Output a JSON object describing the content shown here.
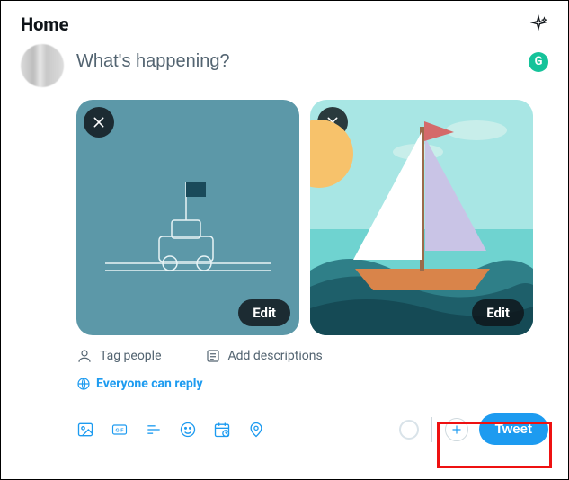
{
  "header": {
    "title": "Home"
  },
  "composer": {
    "placeholder": "What's happening?",
    "grammarly_label": "G"
  },
  "media": [
    {
      "edit_label": "Edit"
    },
    {
      "edit_label": "Edit"
    }
  ],
  "meta": {
    "tag_people": "Tag people",
    "add_descriptions": "Add descriptions"
  },
  "reply_setting": "Everyone can reply",
  "toolbar": {
    "tweet_label": "Tweet"
  },
  "colors": {
    "accent": "#1d9bf0"
  }
}
